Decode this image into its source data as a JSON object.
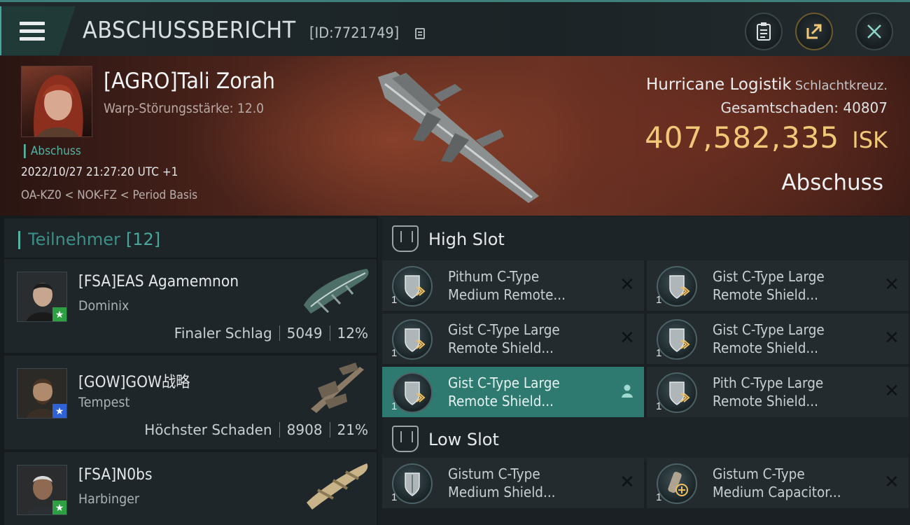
{
  "header": {
    "title": "ABSCHUSSBERICHT",
    "report_id": "[ID:7721749]"
  },
  "victim": {
    "pilot_name": "[AGRO]Tali Zorah",
    "warp_disruption": "Warp-Störungsstärke: 12.0",
    "kill_type": "Abschuss",
    "timestamp": "2022/10/27 21:27:20 UTC +1",
    "location": "OA-KZ0 < NOK-FZ < Period Basis",
    "ship_name": "Hurricane Logistik",
    "ship_class": "Schlachtkreuz.",
    "total_damage": "Gesamtschaden:  40807",
    "isk_value": "407,582,335",
    "isk_unit": "ISK",
    "status": "Abschuss"
  },
  "participants": {
    "label": "Teilnehmer",
    "count": "[12]",
    "items": [
      {
        "name": "[FSA]EAS Agamemnon",
        "ship": "Dominix",
        "role": "Finaler Schlag",
        "damage": "5049",
        "percent": "12%",
        "badge": "★",
        "badge_color": "#2ea043"
      },
      {
        "name": "[GOW]GOW战略",
        "ship": "Tempest",
        "role": "Höchster Schaden",
        "damage": "8908",
        "percent": "21%",
        "badge": "★",
        "badge_color": "#2f62d4"
      },
      {
        "name": "[FSA]N0bs",
        "ship": "Harbinger",
        "role": "",
        "damage": "",
        "percent": "",
        "badge": "★",
        "badge_color": "#2ea043"
      }
    ]
  },
  "fitting": {
    "high_slot_label": "High Slot",
    "low_slot_label": "Low Slot",
    "high_slot": [
      {
        "qty": "1",
        "name": "Pithum C-Type Medium Remote...",
        "action": "✕"
      },
      {
        "qty": "1",
        "name": "Gist C-Type Large Remote Shield...",
        "action": "✕"
      },
      {
        "qty": "1",
        "name": "Gist C-Type Large Remote Shield...",
        "action": "✕"
      },
      {
        "qty": "1",
        "name": "Gist C-Type Large Remote Shield...",
        "action": "✕"
      },
      {
        "qty": "1",
        "name": "Gist C-Type Large Remote Shield...",
        "action": "person"
      },
      {
        "qty": "1",
        "name": "Pith C-Type Large Remote Shield...",
        "action": "✕"
      }
    ],
    "low_slot": [
      {
        "qty": "1",
        "name": "Gistum C-Type Medium Shield...",
        "action": "✕"
      },
      {
        "qty": "1",
        "name": "Gistum C-Type Medium Capacitor...",
        "action": "✕"
      }
    ]
  },
  "colors": {
    "accent_teal": "#54b3a3",
    "isk_gold": "#f0c878",
    "selected_row": "#2e7a70"
  }
}
